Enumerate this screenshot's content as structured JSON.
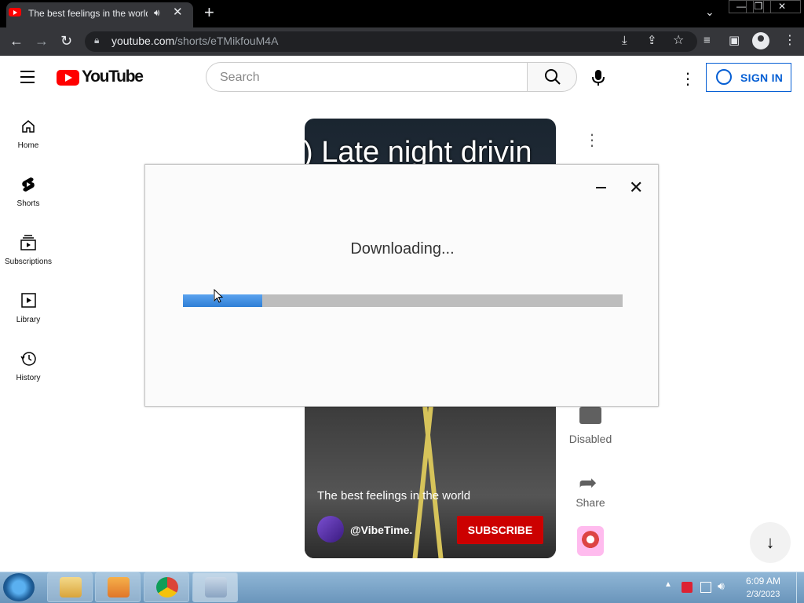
{
  "browser": {
    "tab": {
      "title": "The best feelings in the world",
      "audio_icon": "speaker-icon"
    },
    "address": {
      "host": "youtube.com",
      "path": "/shorts/eTMikfouM4A"
    }
  },
  "youtube": {
    "logo_text": "YouTube",
    "search_placeholder": "Search",
    "signin_label": "SIGN IN",
    "sidebar": [
      {
        "label": "Home",
        "icon": "home-icon"
      },
      {
        "label": "Shorts",
        "icon": "shorts-icon"
      },
      {
        "label": "Subscriptions",
        "icon": "subscriptions-icon"
      },
      {
        "label": "Library",
        "icon": "library-icon"
      },
      {
        "label": "History",
        "icon": "history-icon"
      }
    ],
    "short": {
      "caption_text": ") Late night drivin",
      "title": "The best feelings in the world",
      "channel": "@VibeTime.",
      "subscribe_label": "SUBSCRIBE",
      "comments_label": "Disabled",
      "share_label": "Share"
    }
  },
  "dialog": {
    "status": "Downloading...",
    "progress": 0.18,
    "progress_color": "#3b8ce0"
  },
  "taskbar": {
    "time": "6:09 AM",
    "date": "2/3/2023"
  }
}
